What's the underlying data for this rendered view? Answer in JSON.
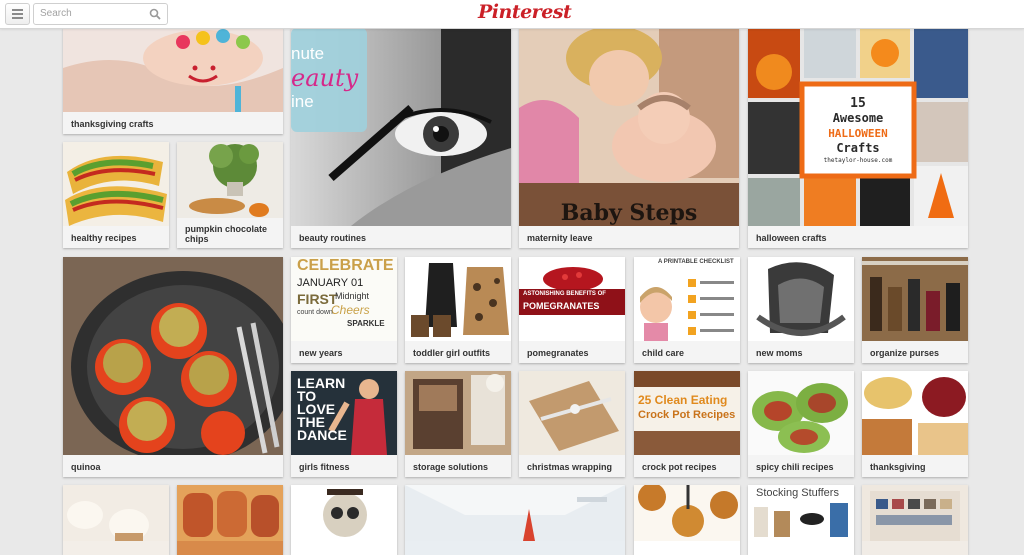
{
  "header": {
    "menu_icon": "hamburger-icon",
    "search_placeholder": "Search",
    "search_icon": "magnifier-icon",
    "logo": "Pinterest",
    "brand_color": "#cb2027"
  },
  "boards": {
    "b1": {
      "label": "thanksgiving crafts"
    },
    "b2": {
      "label": "healthy recipes"
    },
    "b3": {
      "label": "pumpkin chocolate chips"
    },
    "b4": {
      "label": "beauty routines",
      "image_text": [
        "nute",
        "eauty",
        "ine"
      ]
    },
    "b5": {
      "label": "maternity leave",
      "image_text": "Baby Steps"
    },
    "b6": {
      "label": "halloween crafts",
      "image_text": [
        "15",
        "Awesome",
        "HALLOWEEN",
        "Crafts",
        "thetaylor-house.com"
      ]
    },
    "b7": {
      "label": "quinoa"
    },
    "b8": {
      "label": "new years",
      "image_text": [
        "CELEBRATE",
        "JANUARY 01",
        "FIRST",
        "Cheers",
        "Midnight",
        "count down",
        "SPARKLE"
      ]
    },
    "b9": {
      "label": "toddler girl outfits"
    },
    "b10": {
      "label": "pomegranates",
      "image_text": [
        "ASTONISHING BENEFITS OF",
        "POMEGRANATES"
      ]
    },
    "b11": {
      "label": "child care",
      "image_text": [
        "A PRINTABLE CHECKLIST"
      ]
    },
    "b12": {
      "label": "new moms"
    },
    "b13": {
      "label": "organize purses"
    },
    "b14": {
      "label": "girls fitness",
      "image_text": [
        "LEARN",
        "TO",
        "LOVE",
        "THE",
        "DANCE"
      ]
    },
    "b15": {
      "label": "storage solutions"
    },
    "b16": {
      "label": "christmas wrapping"
    },
    "b17": {
      "label": "crock pot recipes",
      "image_text": [
        "25 Clean Eating",
        "Crock Pot Recipes"
      ]
    },
    "b18": {
      "label": "spicy chili recipes"
    },
    "b19": {
      "label": "thanksgiving"
    },
    "b20": {
      "label": ""
    },
    "b21": {
      "label": ""
    },
    "b22": {
      "label": ""
    },
    "b23": {
      "label": ""
    },
    "b24": {
      "label": ""
    },
    "b25": {
      "label": "",
      "image_text": "Stocking Stuffers"
    },
    "b26": {
      "label": ""
    }
  }
}
